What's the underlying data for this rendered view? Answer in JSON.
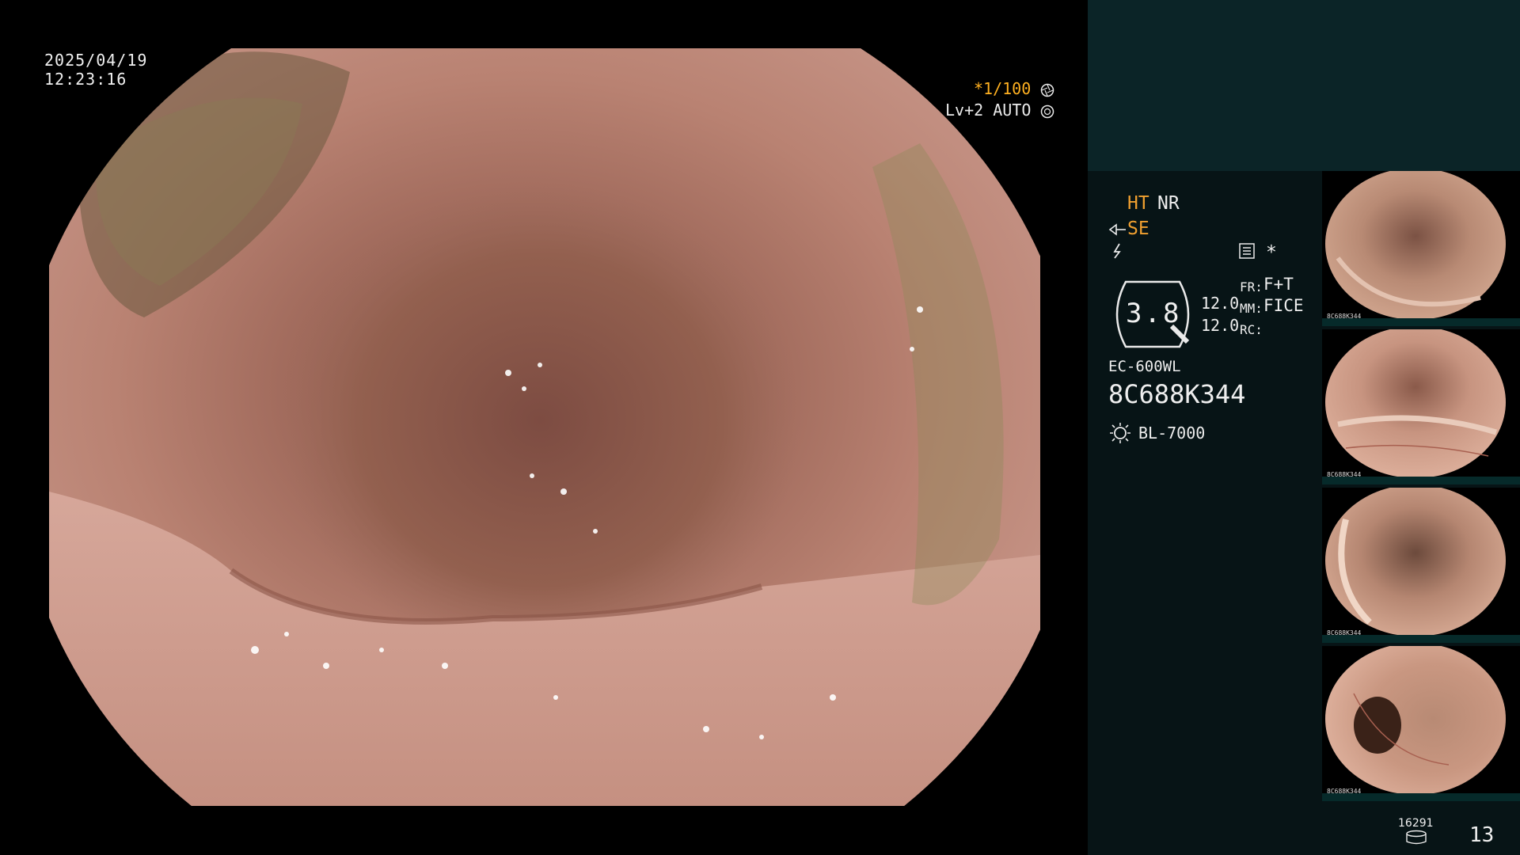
{
  "overlay": {
    "date": "2025/04/19",
    "time": "12:23:16",
    "shutter": "*1/100",
    "level": "Lv+2 AUTO"
  },
  "panel": {
    "mode_ht": "HT",
    "mode_nr": "NR",
    "mode_se": "SE",
    "gauge_value": "3.8",
    "val_top": "12.0",
    "val_bottom": "12.0",
    "fr_label": "FR:",
    "fr_value": "F+T",
    "mm_label": "MM:",
    "mm_value": "FICE",
    "rc_label": "RC:",
    "scope_model": "EC-600WL",
    "scope_serial": "8C688K344",
    "light_source": "BL-7000",
    "storage_count": "16291",
    "image_count": "13"
  },
  "thumbnails": [
    {
      "label": "8C688K344"
    },
    {
      "label": "8C688K344"
    },
    {
      "label": "8C688K344"
    },
    {
      "label": "8C688K344"
    }
  ],
  "colors": {
    "accent_orange": "#f0a030",
    "panel_bg": "#071416",
    "panel_top_bg": "#0b2427",
    "tissue": "#b98272"
  },
  "icons": [
    "aperture-icon",
    "iris-icon",
    "scope-icon",
    "flash-icon",
    "menu-icon",
    "asterisk-icon",
    "lamp-icon",
    "storage-icon"
  ]
}
